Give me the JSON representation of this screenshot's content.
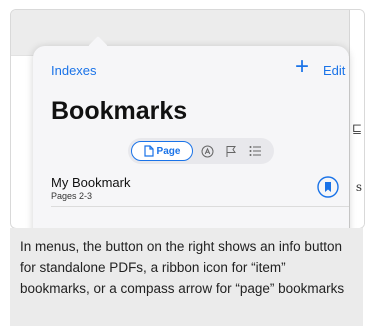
{
  "popover": {
    "back_label": "Indexes",
    "add_label": "+",
    "edit_label": "Edit",
    "title": "Bookmarks"
  },
  "segments": {
    "page_label": "Page",
    "selected": "Page",
    "icons": [
      "page-icon",
      "annotation-icon",
      "flag-icon",
      "list-icon"
    ]
  },
  "bookmarks": [
    {
      "title": "My Bookmark",
      "subtitle": "Pages 2-3",
      "action_icon": "ribbon-icon"
    }
  ],
  "caption": "In menus, the button on the right shows an info button for standalone PDFs, a ribbon icon for “item” bookmarks, or a compass arrow for “page” bookmarks",
  "colors": {
    "accent": "#1a73e8",
    "caption_bg": "#ebebeb",
    "popover_bg": "#f6f6f8"
  }
}
